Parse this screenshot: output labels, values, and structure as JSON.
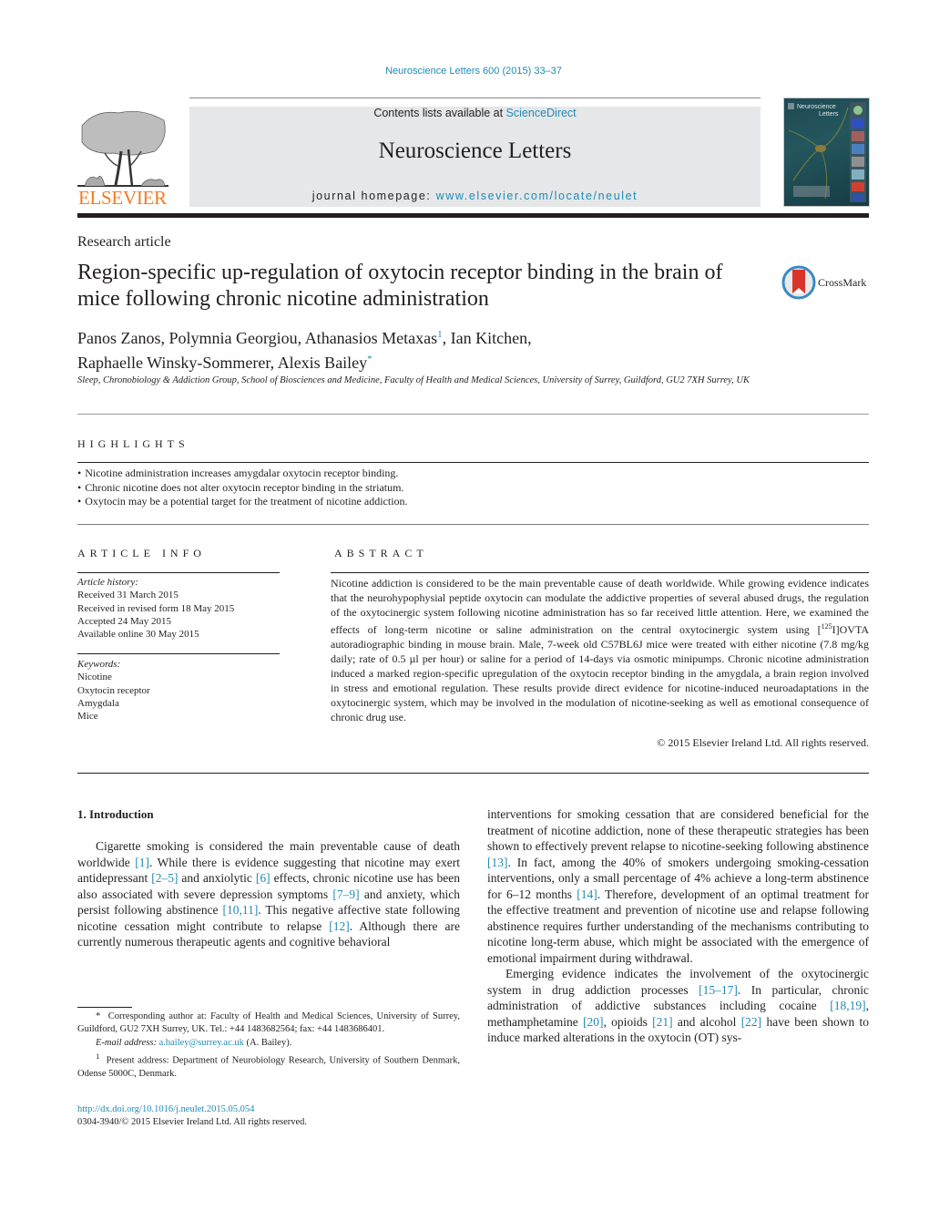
{
  "citation": "Neuroscience Letters 600 (2015) 33–37",
  "header": {
    "publisher_logo_text": "ELSEVIER",
    "contents_prefix": "Contents lists available at ",
    "contents_link": "ScienceDirect",
    "journal_title": "Neuroscience Letters",
    "homepage_prefix": "journal homepage: ",
    "homepage_link": "www.elsevier.com/locate/neulet",
    "cover_title_line1": "Neuroscience",
    "cover_title_line2": "Letters"
  },
  "article": {
    "type": "Research article",
    "title": "Region-specific up-regulation of oxytocin receptor binding in the brain of mice following chronic nicotine administration",
    "crossmark_label": "CrossMark",
    "authors_line1": [
      {
        "name": "Panos Zanos",
        "sep": ", "
      },
      {
        "name": "Polymnia Georgiou",
        "sep": ", "
      },
      {
        "name": "Athanasios Metaxas",
        "mark": "1",
        "sep": ", "
      },
      {
        "name": "Ian Kitchen",
        "sep": ","
      }
    ],
    "authors_line2": [
      {
        "name": "Raphaelle Winsky-Sommerer",
        "sep": ", "
      },
      {
        "name": "Alexis Bailey",
        "mark": "*",
        "sep": ""
      }
    ],
    "affiliation": "Sleep, Chronobiology & Addiction Group, School of Biosciences and Medicine, Faculty of Health and Medical Sciences, University of Surrey, Guildford, GU2 7XH Surrey, UK"
  },
  "highlights": {
    "heading": "HIGHLIGHTS",
    "items": [
      "Nicotine administration increases amygdalar oxytocin receptor binding.",
      "Chronic nicotine does not alter oxytocin receptor binding in the striatum.",
      "Oxytocin may be a potential target for the treatment of nicotine addiction."
    ]
  },
  "article_info": {
    "heading": "ARTICLE INFO",
    "history_label": "Article history:",
    "history": [
      "Received 31 March 2015",
      "Received in revised form 18 May 2015",
      "Accepted 24 May 2015",
      "Available online 30 May 2015"
    ],
    "keywords_label": "Keywords:",
    "keywords": [
      "Nicotine",
      "Oxytocin receptor",
      "Amygdala",
      "Mice"
    ]
  },
  "abstract": {
    "heading": "ABSTRACT",
    "text_part1": "Nicotine addiction is considered to be the main preventable cause of death worldwide. While growing evidence indicates that the neurohypophysial peptide oxytocin can modulate the addictive properties of several abused drugs, the regulation of the oxytocinergic system following nicotine administration has so far received little attention. Here, we examined the effects of long-term nicotine or saline administration on the central oxytocinergic system using [",
    "isotope_sup": "125",
    "text_part2": "I]OVTA autoradiographic binding in mouse brain. Male, 7-week old C57BL6J mice were treated with either nicotine (7.8 mg/kg daily; rate of 0.5 µl per hour) or saline for a period of 14-days via osmotic minipumps. Chronic nicotine administration induced a marked region-specific upregulation of the oxytocin receptor binding in the amygdala, a brain region involved in stress and emotional regulation. These results provide direct evidence for nicotine-induced neuroadaptations in the oxytocinergic system, which may be involved in the modulation of nicotine-seeking as well as emotional consequence of chronic drug use.",
    "copyright": "© 2015 Elsevier Ireland Ltd. All rights reserved."
  },
  "body": {
    "section_heading": "1.  Introduction",
    "left_column": [
      {
        "t": "Cigarette smoking is considered the main preventable cause of death worldwide "
      },
      {
        "ref": "[1]"
      },
      {
        "t": ". While there is evidence suggesting that nicotine may exert antidepressant "
      },
      {
        "ref": "[2–5]"
      },
      {
        "t": " and anxiolytic "
      },
      {
        "ref": "[6]"
      },
      {
        "t": " effects, chronic nicotine use has been also associated with severe depression symptoms "
      },
      {
        "ref": "[7–9]"
      },
      {
        "t": " and anxiety, which persist following abstinence "
      },
      {
        "ref": "[10,11]"
      },
      {
        "t": ". This negative affective state following nicotine cessation might contribute to relapse "
      },
      {
        "ref": "[12]"
      },
      {
        "t": ". Although there are currently numerous therapeutic agents and cognitive behavioral"
      }
    ],
    "right_column_p1": [
      {
        "t": "interventions for smoking cessation that are considered beneficial for the treatment of nicotine addiction, none of these therapeutic strategies has been shown to effectively prevent relapse to nicotine-seeking following abstinence "
      },
      {
        "ref": "[13]"
      },
      {
        "t": ". In fact, among the 40% of smokers undergoing smoking-cessation interventions, only a small percentage of 4% achieve a long-term abstinence for 6–12 months "
      },
      {
        "ref": "[14]"
      },
      {
        "t": ". Therefore, development of an optimal treatment for the effective treatment and prevention of nicotine use and relapse following abstinence requires further understanding of the mechanisms contributing to nicotine long-term abuse, which might be associated with the emergence of emotional impairment during withdrawal."
      }
    ],
    "right_column_p2": [
      {
        "t": "Emerging evidence indicates the involvement of the oxytocinergic system in drug addiction processes "
      },
      {
        "ref": "[15–17]"
      },
      {
        "t": ". In particular, chronic administration of addictive substances including cocaine "
      },
      {
        "ref": "[18,19]"
      },
      {
        "t": ", methamphetamine "
      },
      {
        "ref": "[20]"
      },
      {
        "t": ", opioids "
      },
      {
        "ref": "[21]"
      },
      {
        "t": " and alcohol "
      },
      {
        "ref": "[22]"
      },
      {
        "t": " have been shown to induce marked alterations in the oxytocin (OT) sys-"
      }
    ]
  },
  "footnotes": {
    "corresponding_mark": "*",
    "corresponding_text": "Corresponding author at: Faculty of Health and Medical Sciences, University of Surrey, Guildford, GU2 7XH Surrey, UK. Tel.: +44 1483682564; fax: +44 1483686401.",
    "email_label": "E-mail address: ",
    "email": "a.bailey@surrey.ac.uk",
    "email_suffix": " (A. Bailey).",
    "present_mark": "1",
    "present_text": "Present address: Department of Neurobiology Research, University of Southern Denmark, Odense 5000C, Denmark.",
    "doi": "http://dx.doi.org/10.1016/j.neulet.2015.05.054",
    "issn_copyright": "0304-3940/© 2015 Elsevier Ireland Ltd. All rights reserved."
  },
  "colors": {
    "link": "#1f8bb7",
    "elsevier_orange": "#f47b20",
    "header_band": "#e6e7e8",
    "text": "#231f20"
  }
}
